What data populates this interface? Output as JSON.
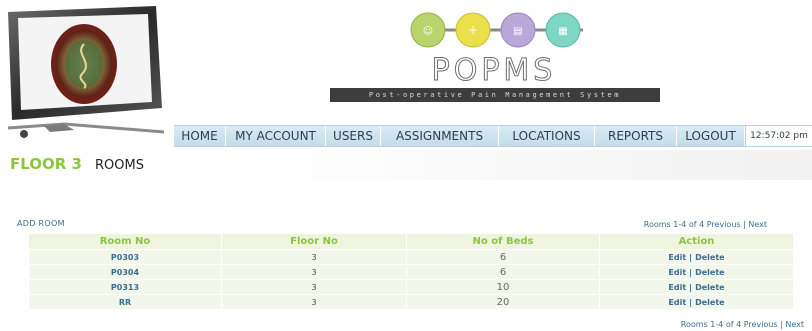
{
  "logo": {
    "wordmark": "POPMS",
    "tagline": "Post-operative Pain Management System",
    "dot_colors": [
      "#b8d46a",
      "#ece04a",
      "#b9a8d8",
      "#7ed6c4"
    ]
  },
  "nav": {
    "items": [
      {
        "id": "home",
        "label": "HOME"
      },
      {
        "id": "my-account",
        "label": "MY ACCOUNT"
      },
      {
        "id": "users",
        "label": "USERS"
      },
      {
        "id": "assignments",
        "label": "ASSIGNMENTS"
      },
      {
        "id": "locations",
        "label": "LOCATIONS"
      },
      {
        "id": "reports",
        "label": "REPORTS"
      },
      {
        "id": "logout",
        "label": "LOGOUT"
      }
    ],
    "clock": "12:57:02 pm"
  },
  "page": {
    "floor_title": "FLOOR 3",
    "section_title": "ROOMS"
  },
  "actions": {
    "add_room": "ADD ROOM"
  },
  "pager": {
    "summary": "Rooms 1-4 of 4",
    "previous": "Previous",
    "separator": "|",
    "next": "Next"
  },
  "table": {
    "headers": {
      "room_no": "Room No",
      "floor_no": "Floor No",
      "beds": "No of Beds",
      "action": "Action"
    },
    "rows": [
      {
        "room_no": "P0303",
        "floor_no": "3",
        "beds": "6",
        "edit": "Edit",
        "delete": "Delete"
      },
      {
        "room_no": "P0304",
        "floor_no": "3",
        "beds": "6",
        "edit": "Edit",
        "delete": "Delete"
      },
      {
        "room_no": "P0313",
        "floor_no": "3",
        "beds": "10",
        "edit": "Edit",
        "delete": "Delete"
      },
      {
        "room_no": "RR",
        "floor_no": "3",
        "beds": "20",
        "edit": "Edit",
        "delete": "Delete"
      }
    ],
    "action_separator": "|"
  },
  "colors": {
    "accent_green": "#8cc63e",
    "link_blue": "#3c6e8f",
    "nav_bg": "#cfe4ef"
  }
}
